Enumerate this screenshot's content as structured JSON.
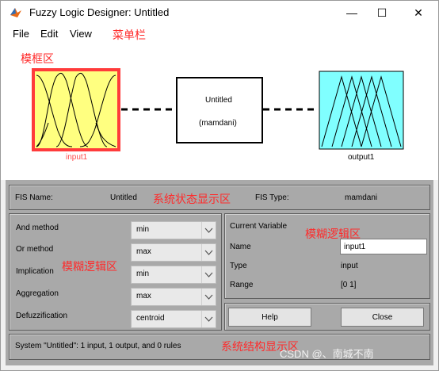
{
  "window": {
    "title": "Fuzzy Logic Designer: Untitled"
  },
  "controls": {
    "minimize": "—",
    "maximize": "☐",
    "close": "✕"
  },
  "menu": {
    "items": [
      "File",
      "Edit",
      "View"
    ]
  },
  "annotations": {
    "menubar": "菜单栏",
    "diagram": "模框区",
    "status": "系统状态显示区",
    "rules": "模糊逻辑区",
    "variable": "模糊逻辑区",
    "structure": "系统结构显示区"
  },
  "diagram": {
    "input_label": "input1",
    "system_name": "Untitled",
    "system_type": "(mamdani)",
    "output_label": "output1"
  },
  "fis": {
    "name_label": "FIS Name:",
    "name_value": "Untitled",
    "type_label": "FIS Type:",
    "type_value": "mamdani"
  },
  "methods": [
    {
      "label": "And method",
      "value": "min"
    },
    {
      "label": "Or method",
      "value": "max"
    },
    {
      "label": "Implication",
      "value": "min"
    },
    {
      "label": "Aggregation",
      "value": "max"
    },
    {
      "label": "Defuzzification",
      "value": "centroid"
    }
  ],
  "current_variable": {
    "title": "Current Variable",
    "name_label": "Name",
    "name_value": "input1",
    "type_label": "Type",
    "type_value": "input",
    "range_label": "Range",
    "range_value": "[0 1]"
  },
  "buttons": {
    "help": "Help",
    "close": "Close"
  },
  "status": "System \"Untitled\": 1 input, 1 output, and 0 rules",
  "watermark": "CSDN @、南城不南",
  "colors": {
    "input_fill": "#ffff80",
    "input_border": "#ff3b3b",
    "output_fill": "#80ffff",
    "panel_bg": "#a9a9a9"
  }
}
